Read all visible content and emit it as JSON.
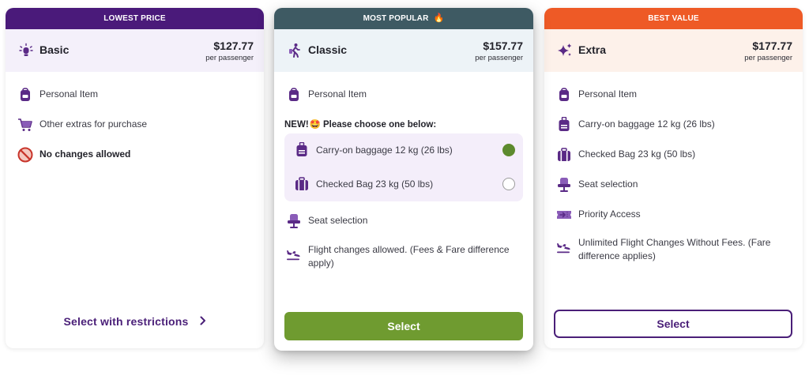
{
  "colors": {
    "banner_basic": "#4a1a7a",
    "banner_classic": "#3e5a63",
    "banner_extra": "#ee5a26",
    "head_basic": "#f4f0fa",
    "head_classic": "#edf3f7",
    "head_extra": "#fdf1ea",
    "icon_purple": "#5a2a86",
    "select_green": "#6f9b30",
    "outline_purple": "#4a1f78"
  },
  "basic": {
    "banner": "LOWEST PRICE",
    "icon": "lightbulb-icon",
    "name": "Basic",
    "price": "$127.77",
    "per": "per passenger",
    "features": [
      {
        "icon": "backpack-icon",
        "label": "Personal Item"
      },
      {
        "icon": "cart-icon",
        "label": "Other extras for purchase"
      },
      {
        "icon": "no-entry-icon",
        "label": "No changes allowed"
      }
    ],
    "cta": "Select with restrictions",
    "cta_icon": "chevron-right-icon"
  },
  "classic": {
    "banner": "MOST POPULAR",
    "banner_emoji": "🔥",
    "icon": "walking-traveler-icon",
    "name": "Classic",
    "price": "$157.77",
    "per": "per passenger",
    "feature_personal": {
      "icon": "backpack-icon",
      "label": "Personal Item"
    },
    "new_label": "NEW!",
    "new_emoji": "🤩",
    "new_text": "Please choose one below:",
    "choices": [
      {
        "icon": "carry-on-icon",
        "label": "Carry-on baggage 12 kg (26 lbs)",
        "selected": true
      },
      {
        "icon": "checked-bag-icon",
        "label": "Checked Bag 23 kg (50 lbs)",
        "selected": false
      }
    ],
    "feature_seat": {
      "icon": "seat-icon",
      "label": "Seat selection"
    },
    "feature_changes": {
      "icon": "plane-icon",
      "label_line1": "Flight changes allowed. (Fees & Fare difference",
      "label_line2": "apply)"
    },
    "cta": "Select"
  },
  "extra": {
    "banner": "BEST VALUE",
    "icon": "sparkles-icon",
    "name": "Extra",
    "price": "$177.77",
    "per": "per passenger",
    "features": [
      {
        "icon": "backpack-icon",
        "label": "Personal Item"
      },
      {
        "icon": "carry-on-icon",
        "label": "Carry-on baggage 12 kg (26 lbs)"
      },
      {
        "icon": "checked-bag-icon",
        "label": "Checked Bag 23 kg (50 lbs)"
      },
      {
        "icon": "seat-icon",
        "label": "Seat selection"
      },
      {
        "icon": "priority-ticket-icon",
        "label": "Priority Access"
      }
    ],
    "feature_changes": {
      "icon": "plane-icon",
      "label_line1": "Unlimited Flight Changes Without Fees. (Fare",
      "label_line2": "difference applies)"
    },
    "cta": "Select"
  }
}
